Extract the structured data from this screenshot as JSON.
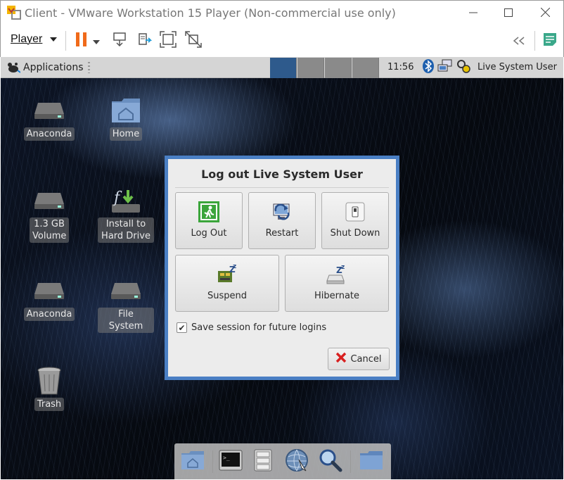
{
  "window": {
    "title": "Client - VMware Workstation 15 Player (Non-commercial use only)",
    "controls": [
      "minimize-icon",
      "maximize-icon",
      "close-icon"
    ]
  },
  "toolbar": {
    "player_menu": "Player",
    "icons": [
      "pause-icon",
      "dropdown-arrow-icon",
      "send-ctrl-alt-del-icon",
      "removable-devices-icon",
      "full-screen-icon",
      "unity-icon",
      "collapse-icon",
      "notes-icon"
    ]
  },
  "panel": {
    "applications": "Applications",
    "workspaces": 4,
    "active_workspace": 1,
    "clock": "11:56",
    "tray_icons": [
      "bluetooth-icon",
      "network-icon",
      "updates-icon"
    ],
    "user": "Live System User"
  },
  "desktop": {
    "icons": [
      {
        "label": "Anaconda",
        "icon": "drive-icon"
      },
      {
        "label": "Home",
        "icon": "home-folder-icon"
      },
      {
        "label": "1.3 GB Volume",
        "icon": "drive-icon"
      },
      {
        "label": "Install to Hard Drive",
        "icon": "install-icon"
      },
      {
        "label": "Anaconda",
        "icon": "drive-icon"
      },
      {
        "label": "File System",
        "icon": "drive-icon"
      },
      {
        "label": "Trash",
        "icon": "trash-icon"
      }
    ]
  },
  "dialog": {
    "title": "Log out Live System User",
    "options": [
      {
        "label": "Log Out",
        "icon": "exit-icon"
      },
      {
        "label": "Restart",
        "icon": "restart-icon"
      },
      {
        "label": "Shut Down",
        "icon": "power-switch-icon"
      },
      {
        "label": "Suspend",
        "icon": "suspend-icon"
      },
      {
        "label": "Hibernate",
        "icon": "hibernate-icon"
      }
    ],
    "save_session": {
      "label": "Save session for future logins",
      "checked": true
    },
    "cancel_label": "Cancel"
  },
  "dock": {
    "items": [
      "home-folder-icon",
      "terminal-icon",
      "file-manager-icon",
      "web-browser-icon",
      "search-icon",
      "folder-icon"
    ]
  },
  "colors": {
    "dialog_border": "#4a7fc4",
    "active_workspace": "#2e5a8c",
    "pause_orange": "#f06a1a"
  }
}
